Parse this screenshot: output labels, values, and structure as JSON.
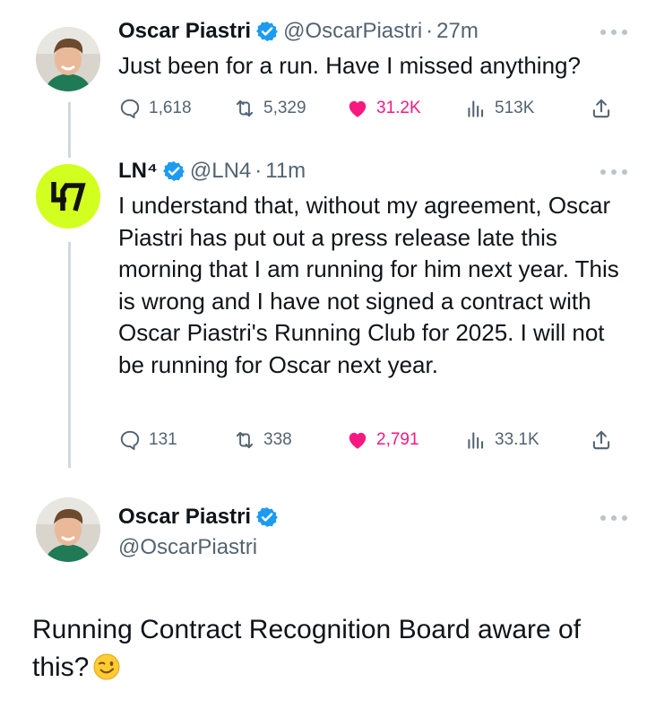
{
  "tweets": [
    {
      "name": "Oscar Piastri",
      "handle": "@OscarPiastri",
      "separator": "·",
      "time": "27m",
      "text": "Just been for a run. Have I missed anything?",
      "stats": {
        "replies": "1,618",
        "reposts": "5,329",
        "likes": "31.2K",
        "views": "513K"
      }
    },
    {
      "name": "LN⁴",
      "handle": "@LN4",
      "separator": "·",
      "time": "11m",
      "text": "I understand that, without my agreement, Oscar Piastri has put out a press release late this morning that I am running for him next year. This is wrong and I have not signed a contract with Oscar Piastri's Running Club for 2025. I will not be running for Oscar next year.",
      "stats": {
        "replies": "131",
        "reposts": "338",
        "likes": "2,791",
        "views": "33.1K"
      }
    }
  ],
  "reply": {
    "name": "Oscar Piastri",
    "handle": "@OscarPiastri",
    "text": "Running Contract Recognition Board aware of this?",
    "emoji": "winking-face-emoji"
  },
  "colors": {
    "verified_blue": "#1d9bf0",
    "like_pink": "#f91880",
    "ln4_avatar_yellow": "#d2ff1f",
    "text_secondary": "#536471"
  }
}
